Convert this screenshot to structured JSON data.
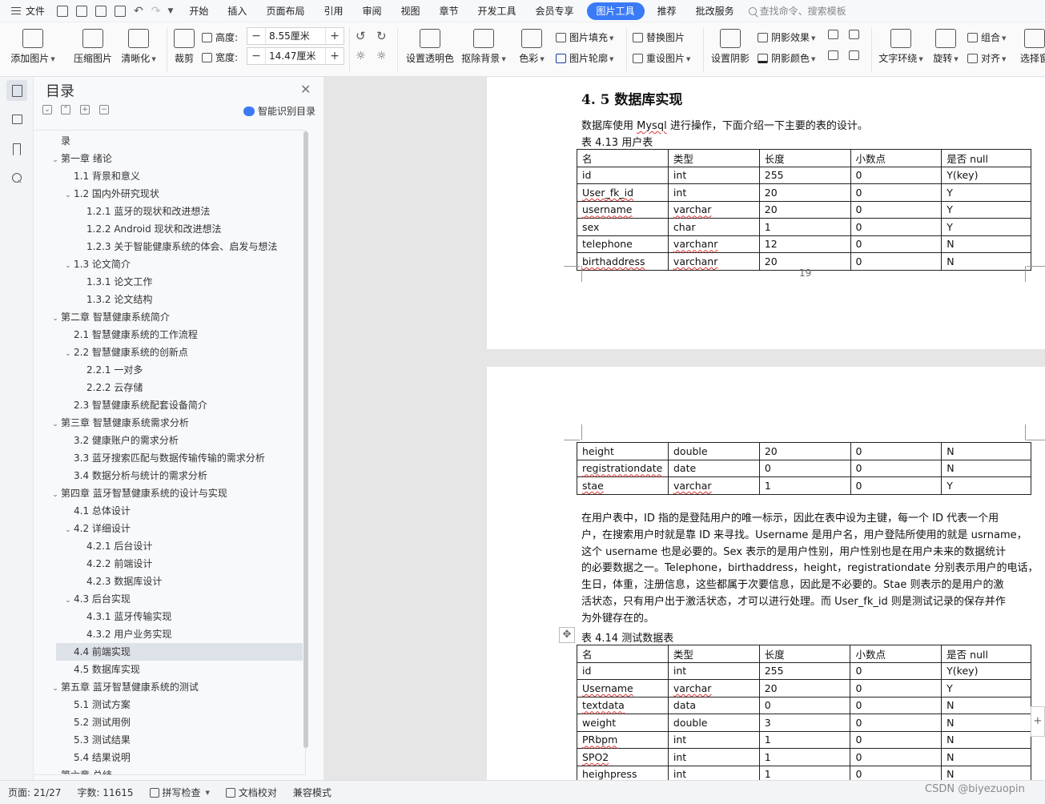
{
  "menubar": {
    "file_label": "文件",
    "tabs": [
      "开始",
      "插入",
      "页面布局",
      "引用",
      "审阅",
      "视图",
      "章节",
      "开发工具",
      "会员专享",
      "图片工具",
      "推荐",
      "批改服务"
    ],
    "active_tab": "图片工具",
    "search_placeholder": "查找命令、搜索模板"
  },
  "ribbon": {
    "add_picture": "添加图片",
    "compress": "压缩图片",
    "sharpen": "清晰化",
    "crop": "裁剪",
    "height_label": "高度:",
    "height_value": "8.55厘米",
    "width_label": "宽度:",
    "width_value": "14.47厘米",
    "set_transparent": "设置透明色",
    "remove_bg": "抠除背景",
    "color": "色彩",
    "picture_fill": "图片填充",
    "picture_outline": "图片轮廓",
    "replace_picture": "替换图片",
    "reset_picture": "重设图片",
    "set_shadow": "设置阴影",
    "shadow_effect": "阴影效果",
    "shadow_color": "阴影颜色",
    "text_wrap": "文字环绕",
    "rotate": "旋转",
    "group": "组合",
    "align": "对齐",
    "select": "选择窗"
  },
  "toc": {
    "title": "目录",
    "smart_label": "智能识别目录",
    "items": [
      {
        "text": "录",
        "level": 0,
        "chev": ""
      },
      {
        "text": "第一章  绪论",
        "level": 0,
        "chev": "v"
      },
      {
        "text": "1.1 背景和意义",
        "level": 1,
        "chev": ""
      },
      {
        "text": "1.2 国内外研究现状",
        "level": 1,
        "chev": "v"
      },
      {
        "text": "1.2.1  蓝牙的现状和改进想法",
        "level": 2,
        "chev": ""
      },
      {
        "text": "1.2.2 Android 现状和改进想法",
        "level": 2,
        "chev": ""
      },
      {
        "text": "1.2.3  关于智能健康系统的体会、启发与想法",
        "level": 2,
        "chev": ""
      },
      {
        "text": "1.3 论文简介",
        "level": 1,
        "chev": "v"
      },
      {
        "text": "1.3.1 论文工作",
        "level": 2,
        "chev": ""
      },
      {
        "text": "1.3.2 论文结构",
        "level": 2,
        "chev": ""
      },
      {
        "text": "第二章  智慧健康系统简介",
        "level": 0,
        "chev": "v"
      },
      {
        "text": "2.1 智慧健康系统的工作流程",
        "level": 1,
        "chev": ""
      },
      {
        "text": "2.2 智慧健康系统的创新点",
        "level": 1,
        "chev": "v"
      },
      {
        "text": "2.2.1 一对多",
        "level": 2,
        "chev": ""
      },
      {
        "text": "2.2.2 云存储",
        "level": 2,
        "chev": ""
      },
      {
        "text": "2.3 智慧健康系统配套设备简介",
        "level": 1,
        "chev": ""
      },
      {
        "text": "第三章  智慧健康系统需求分析",
        "level": 0,
        "chev": "v"
      },
      {
        "text": "3.2 健康账户的需求分析",
        "level": 1,
        "chev": ""
      },
      {
        "text": "3.3 蓝牙搜索匹配与数据传输传输的需求分析",
        "level": 1,
        "chev": ""
      },
      {
        "text": "3.4 数据分析与统计的需求分析",
        "level": 1,
        "chev": ""
      },
      {
        "text": "第四章  蓝牙智慧健康系统的设计与实现",
        "level": 0,
        "chev": "v"
      },
      {
        "text": "4.1 总体设计",
        "level": 1,
        "chev": ""
      },
      {
        "text": "4.2 详细设计",
        "level": 1,
        "chev": "v"
      },
      {
        "text": "4.2.1 后台设计",
        "level": 2,
        "chev": ""
      },
      {
        "text": "4.2.2 前端设计",
        "level": 2,
        "chev": ""
      },
      {
        "text": "4.2.3 数据库设计",
        "level": 2,
        "chev": ""
      },
      {
        "text": "4.3 后台实现",
        "level": 1,
        "chev": "v"
      },
      {
        "text": "4.3.1 蓝牙传输实现",
        "level": 2,
        "chev": ""
      },
      {
        "text": "4.3.2 用户业务实现",
        "level": 2,
        "chev": ""
      },
      {
        "text": "4.4 前端实现",
        "level": 1,
        "chev": "",
        "selected": true
      },
      {
        "text": "4.5 数据库实现",
        "level": 1,
        "chev": ""
      },
      {
        "text": "第五章  蓝牙智慧健康系统的测试",
        "level": 0,
        "chev": "v"
      },
      {
        "text": "5.1 测试方案",
        "level": 1,
        "chev": ""
      },
      {
        "text": "5.2 测试用例",
        "level": 1,
        "chev": ""
      },
      {
        "text": "5.3 测试结果",
        "level": 1,
        "chev": ""
      },
      {
        "text": "5.4 结果说明",
        "level": 1,
        "chev": ""
      },
      {
        "text": "第六章  总结",
        "level": 0,
        "chev": ""
      }
    ]
  },
  "doc": {
    "heading": "4. 5 数据库实现",
    "intro": "数据库使用 Mysql 进行操作，下面介绍一下主要的表的设计。",
    "table1_caption": "表 4.13 用户表",
    "table1_header": [
      "名",
      "类型",
      "长度",
      "小数点",
      "是否 null"
    ],
    "table1_rows": [
      [
        "id",
        "int",
        "255",
        "0",
        "Y(key)"
      ],
      [
        "User_fk_id",
        "int",
        "20",
        "0",
        "Y"
      ],
      [
        "username",
        "varchar",
        "20",
        "0",
        "Y"
      ],
      [
        "sex",
        "char",
        "1",
        "0",
        "Y"
      ],
      [
        "telephone",
        "varchanr",
        "12",
        "0",
        "N"
      ],
      [
        "birthaddress",
        "varchanr",
        "20",
        "0",
        "N"
      ]
    ],
    "page_number": "19",
    "table1_cont_rows": [
      [
        "height",
        "double",
        "20",
        "0",
        "N"
      ],
      [
        "registrationdate",
        "date",
        "0",
        "0",
        "N"
      ],
      [
        "stae",
        "varchar",
        "1",
        "0",
        "Y"
      ]
    ],
    "para_lines": [
      "在用户表中，ID 指的是登陆用户的唯一标示，因此在表中设为主键，每一个 ID 代表一个用",
      "户，在搜索用户时就是靠 ID 来寻找。Username 是用户名，用户登陆所使用的就是 usrname，",
      "这个 username 也是必要的。Sex 表示的是用户性别，用户性别也是在用户未来的数据统计",
      "的必要数据之一。Telephone，birthaddress，height，registrationdate 分别表示用户的电话，",
      "生日，体重，注册信息，这些都属于次要信息，因此是不必要的。Stae 则表示的是用户的激",
      "活状态，只有用户出于激活状态，才可以进行处理。而 User_fk_id 则是测试记录的保存并作",
      "为外键存在的。"
    ],
    "table2_caption": "表 4.14 测试数据表",
    "table2_header": [
      "名",
      "类型",
      "长度",
      "小数点",
      "是否 null"
    ],
    "table2_rows": [
      [
        "id",
        "int",
        "255",
        "0",
        "Y(key)"
      ],
      [
        "Username",
        "varchar",
        "20",
        "0",
        "Y"
      ],
      [
        "textdata",
        "data",
        "0",
        "0",
        "N"
      ],
      [
        "weight",
        "double",
        "3",
        "0",
        "N"
      ],
      [
        "PRbpm",
        "int",
        "1",
        "0",
        "N"
      ],
      [
        "SPO2",
        "int",
        "1",
        "0",
        "N"
      ],
      [
        "heighpress",
        "int",
        "1",
        "0",
        "N"
      ]
    ]
  },
  "statusbar": {
    "page": "页面: 21/27",
    "words": "字数: 11615",
    "spell": "拼写检查",
    "proof": "文档校对",
    "compat": "兼容模式"
  },
  "watermark": "CSDN @biyezuopin",
  "colors": {
    "accent": "#3a7af5",
    "canvas": "#e6e6e6",
    "panel": "#f8f9fb"
  }
}
